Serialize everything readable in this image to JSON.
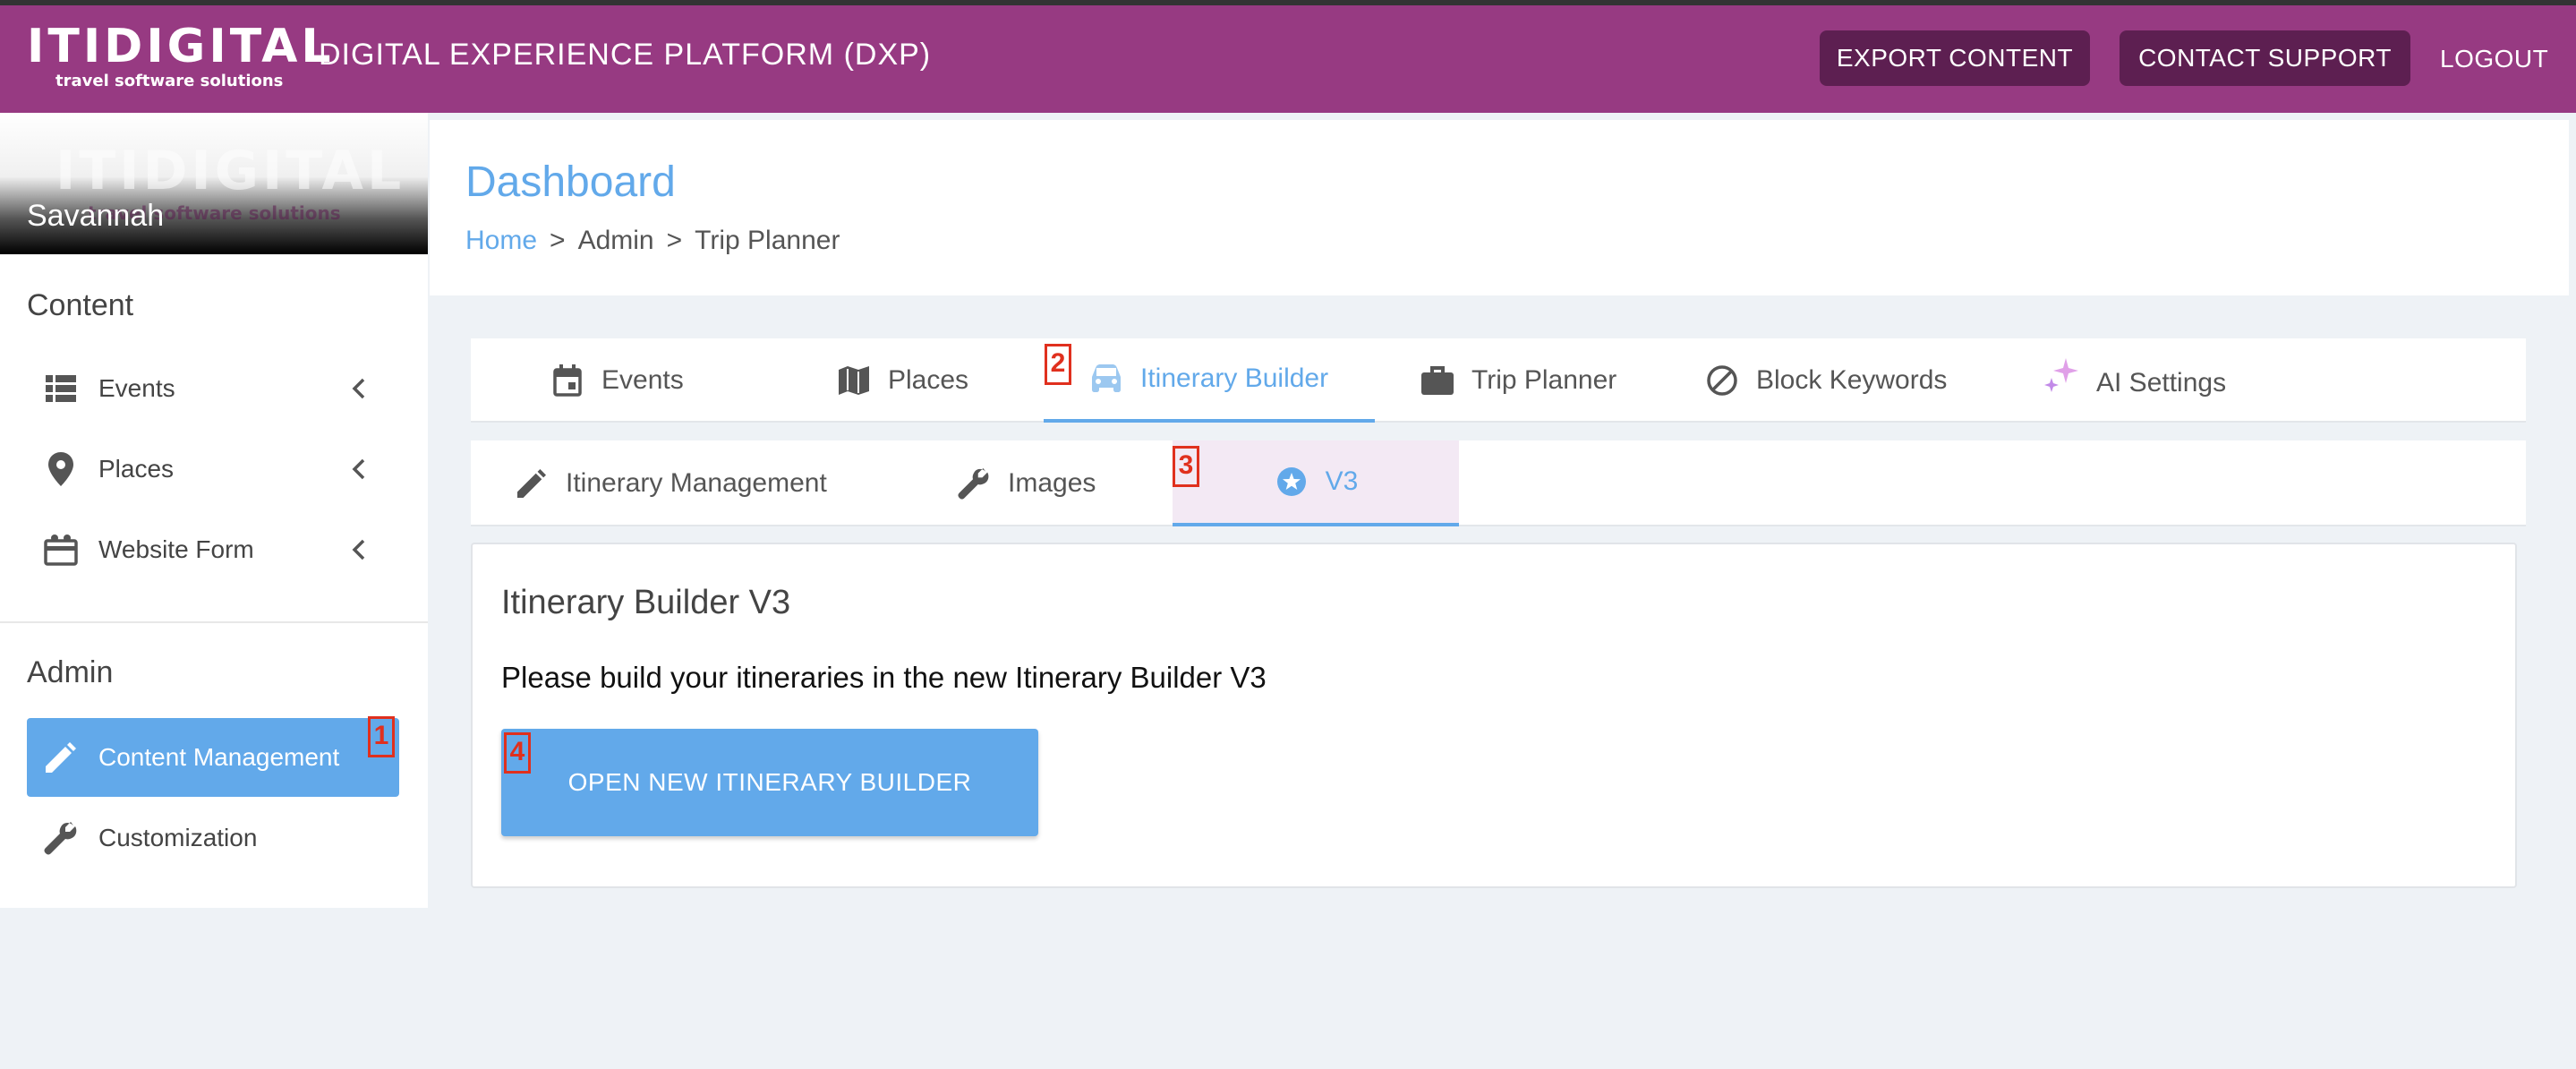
{
  "brand": {
    "logo_text": "ITIDIGITAL",
    "logo_sub": "travel software solutions"
  },
  "header": {
    "platform_title": "DIGITAL EXPERIENCE PLATFORM (DXP)",
    "export_label": "EXPORT CONTENT",
    "support_label": "CONTACT SUPPORT",
    "logout_label": "LOGOUT"
  },
  "sidebar": {
    "user_name": "Savannah",
    "content_title": "Content",
    "content_items": [
      {
        "label": "Events",
        "icon": "list-icon"
      },
      {
        "label": "Places",
        "icon": "map-pin-icon"
      },
      {
        "label": "Website Form",
        "icon": "form-icon"
      }
    ],
    "admin_title": "Admin",
    "admin_items": [
      {
        "label": "Content Management",
        "icon": "pencil-icon",
        "active": true
      },
      {
        "label": "Customization",
        "icon": "wrench-icon",
        "active": false
      }
    ]
  },
  "page": {
    "title": "Dashboard",
    "breadcrumb": [
      "Home",
      "Admin",
      "Trip Planner"
    ]
  },
  "tabs_primary": [
    {
      "label": "Events",
      "icon": "calendar-icon"
    },
    {
      "label": "Places",
      "icon": "map-icon"
    },
    {
      "label": "Itinerary Builder",
      "icon": "car-icon",
      "active": true
    },
    {
      "label": "Trip Planner",
      "icon": "briefcase-icon"
    },
    {
      "label": "Block Keywords",
      "icon": "block-icon"
    },
    {
      "label": "AI Settings",
      "icon": "sparkle-icon"
    }
  ],
  "tabs_secondary": [
    {
      "label": "Itinerary Management",
      "icon": "pencil-icon"
    },
    {
      "label": "Images",
      "icon": "wrench-icon"
    },
    {
      "label": "V3",
      "icon": "star-circle-icon",
      "active": true
    }
  ],
  "panel": {
    "title": "Itinerary Builder V3",
    "text": "Please build your itineraries in the new Itinerary Builder V3",
    "button_label": "OPEN NEW ITINERARY BUILDER"
  },
  "markers": [
    "1",
    "2",
    "3",
    "4"
  ],
  "colors": {
    "topbar": "#973a82",
    "header_button": "#5d1f51",
    "accent": "#62a9ea",
    "page_bg": "#eef2f6",
    "marker": "#e0301e"
  }
}
